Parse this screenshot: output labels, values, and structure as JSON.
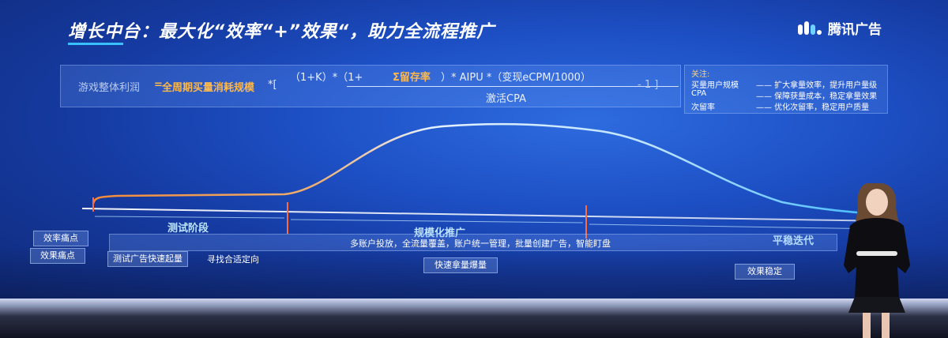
{
  "slide": {
    "title": "增长中台：最大化“效率“+”效果“，助力全流程推广",
    "logo_text": "腾讯广告"
  },
  "formula": {
    "left_label": "游戏整体利润",
    "equals": "=",
    "scale_label": "全周期买量消耗规模",
    "times_bracket": "*[",
    "numerator_1": "（1+K）*（1+",
    "numerator_sigma": "Σ留存率",
    "numerator_2": "）* AIPU *（变现eCPM/1000）",
    "denominator": "激活CPA",
    "tail": "- 1 ]"
  },
  "notes": {
    "title": "关注:",
    "rows": [
      {
        "term": "买量用户规模",
        "desc": "—— 扩大拿量效率，提升用户量级"
      },
      {
        "term": "CPA",
        "desc": "—— 保障获量成本，稳定拿量效果"
      },
      {
        "term": "次留率",
        "desc": "—— 优化次留率，稳定用户质量"
      }
    ]
  },
  "stages": {
    "test": "测试阶段",
    "scale": "规模化推广",
    "stable": "平稳迭代"
  },
  "rows": {
    "efficiency_pain": "效率痛点",
    "effect_pain": "效果痛点",
    "efficiency_desc": "多账户投放，全流量覆盖，账户统一管理，批量创建广告，智能盯盘",
    "test_fast": "测试广告快速起量",
    "find_direction": "寻找合适定向",
    "fast_volume": "快速拿量爆量",
    "effect_stable": "效果稳定"
  },
  "colors": {
    "accent_orange": "#ffb84a",
    "curve_start": "#f28a3a",
    "curve_end": "#3ab8ff",
    "stage_marker": "#ff6a3d"
  }
}
